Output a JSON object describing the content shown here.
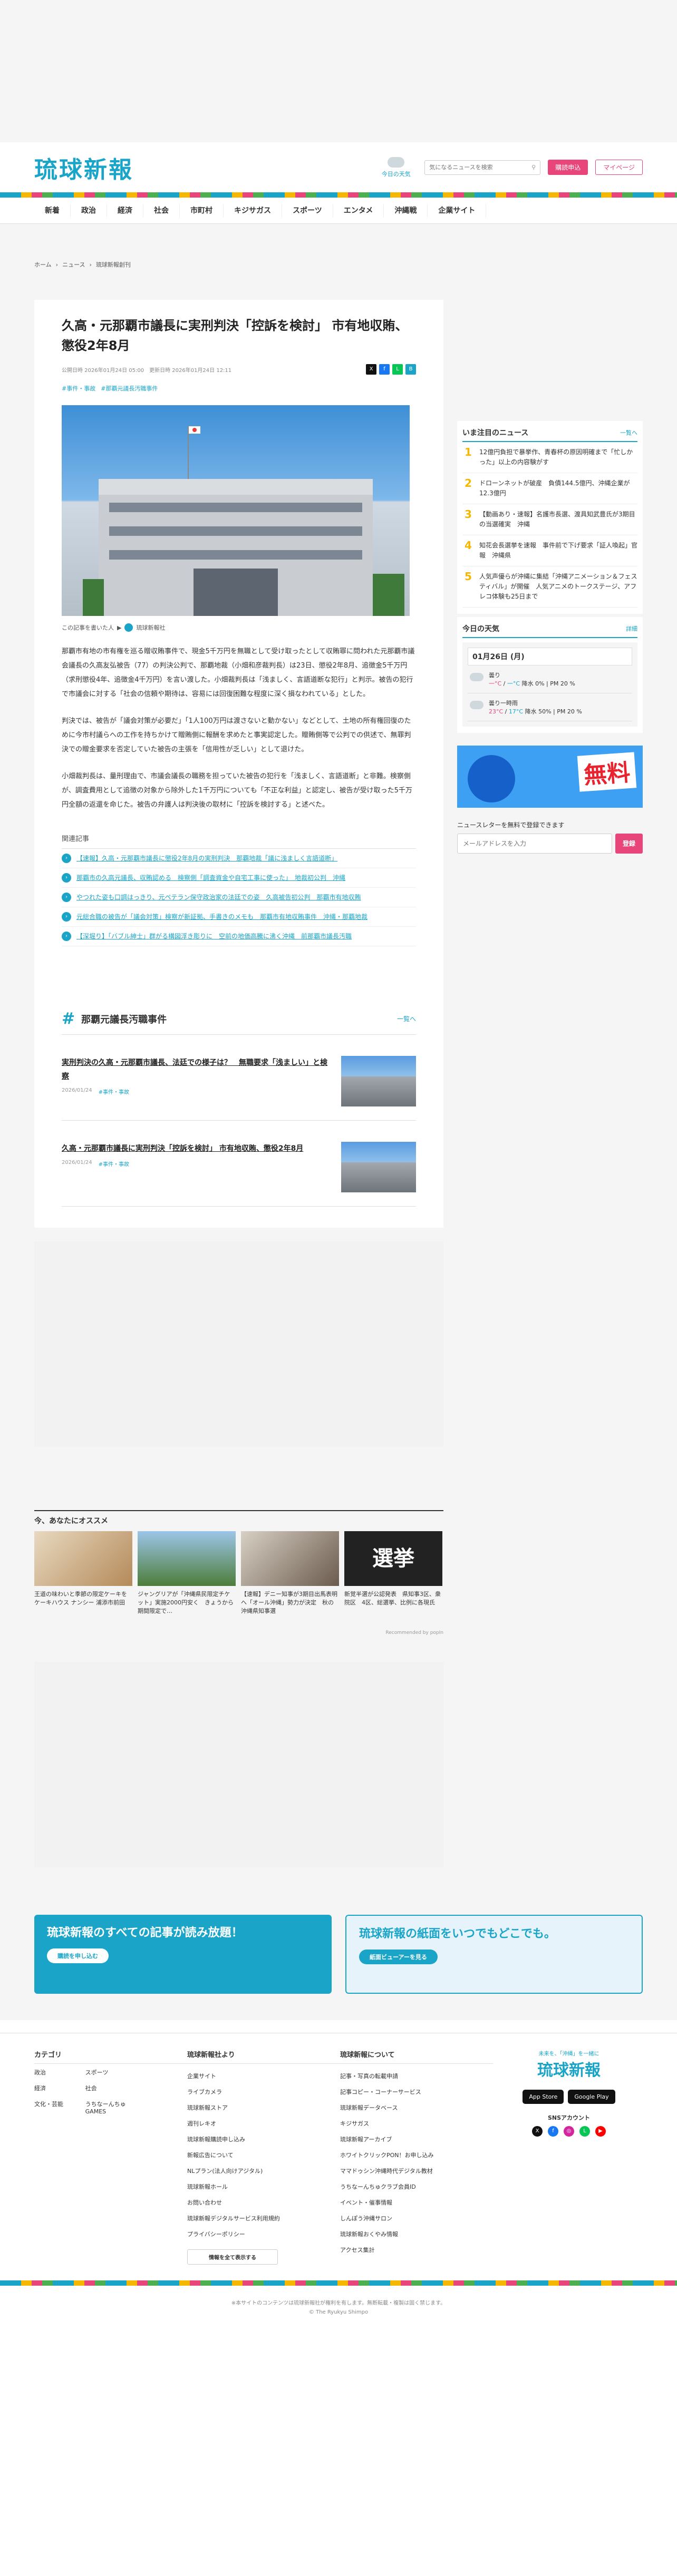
{
  "header": {
    "logo": "琉球新報",
    "weather_label": "今日の天気",
    "search_placeholder": "気になるニュースを検索",
    "subscribe_label": "購読申込",
    "mypage_label": "マイページ"
  },
  "nav": [
    "新着",
    "政治",
    "経済",
    "社会",
    "市町村",
    "キジサガス",
    "スポーツ",
    "エンタメ",
    "沖縄戦",
    "企業サイト"
  ],
  "breadcrumb": [
    "ホーム",
    "ニュース",
    "琉球新報創刊"
  ],
  "article": {
    "title": "久高・元那覇市議長に実刑判決「控訴を検討」 市有地収賄、懲役2年8月",
    "published": "公開日時 2026年01月24日 05:00",
    "updated": "更新日時 2026年01月24日 12:11",
    "tags": [
      "#事件・事故",
      "#那覇元議長汚職事件"
    ],
    "author_label": "この記事を書いた人",
    "author_name": "琉球新報社",
    "paragraphs": [
      "那覇市有地の市有権を巡る贈収賄事件で、現金5千万円を無職として受け取ったとして収賄罪に問われた元那覇市議会議長の久高友弘被告（77）の判決公判で、那覇地裁（小畑和彦裁判長）は23日、懲役2年8月、追徴金5千万円（求刑懲役4年、追徴金4千万円）を言い渡した。小畑裁判長は「浅ましく、言語道断な犯行」と判示。被告の犯行で市議会に対する「社会の信頼や期待は、容易には回復困難な程度に深く損なわれている」とした。",
      "判決では、被告が「議会対策が必要だ」「1人100万円は渡さないと動かない」などとして、土地の所有権回復のために今市村議らへの工作を持ちかけて贈賄側に報酬を求めたと事実認定した。贈賄側等で公判での供述で、無罪判決での贈金要求を否定していた被告の主張を「信用性が乏しい」として退けた。",
      "小畑裁判長は、量刑理由で、市議会議長の職務を担っていた被告の犯行を「浅ましく、言語道断」と非難。検察側が、調査費用として追徴の対象から除外した1千万円についても「不正な利益」と認定し、被告が受け取った5千万円全額の返還を命じた。被告の弁護人は判決後の取材に「控訴を検討する」と述べた。"
    ]
  },
  "related": {
    "heading": "関連記事",
    "items": [
      "【速報】久高・元那覇市議長に懲役2年8月の実刑判決　那覇地裁「議に浅ましく言語道断」",
      "那覇市の久高元議長、収賄認める　検察側「調査資金や自宅工事に使った」　地裁初公判　沖縄",
      "やつれた姿も口調はっきり、元ペテラン保守政治家の法廷での姿　久高被告初公判　那覇市有地収賄",
      "元総合職の被告が「議会対策」検察が新証拠、手書きのメモも　那覇市有地収賄事件　沖縄・那覇地裁",
      "【深堀り】「バブル紳士」群がる構図浮き彫りに　空前の地価高騰に沸く沖縄　前那覇市議長汚職"
    ]
  },
  "series": {
    "title": "那覇元議長汚職事件",
    "more": "一覧へ",
    "cards": [
      {
        "title": "実刑判決の久高・元那覇市議長、法廷での様子は？　無職要求「浅ましい」と検察",
        "date": "2026/01/24",
        "tag": "#事件・事故"
      },
      {
        "title": "久高・元那覇市議長に実刑判決「控訴を検討」 市有地収賄、懲役2年8月",
        "date": "2026/01/24",
        "tag": "#事件・事故"
      }
    ]
  },
  "sidebar": {
    "ranking_title": "いま注目のニュース",
    "ranking_more": "一覧へ",
    "ranking": [
      {
        "num": "1",
        "text": "12億円負担で暴挙作、青春杯の原因明確まで「忙しかった」以上の内容験がす"
      },
      {
        "num": "2",
        "text": "ドローンネットが破産　負債144.5億円、沖縄企業が12.3億円"
      },
      {
        "num": "3",
        "text": "【動画あり・速報】名護市長選、渡具知武豊氏が3期目の当選確実　沖縄"
      },
      {
        "num": "4",
        "text": "知花会長選挙を速報　事件前で下げ要求「証人喚起」官報　沖縄県"
      },
      {
        "num": "5",
        "text": "人気声優らが沖縄に集結「沖縄アニメーション＆フェスティバル」が開催　人気アニメのトークステージ、アフレコ体験も25日まで"
      }
    ],
    "weather_title": "今日の天気",
    "weather_more": "詳細",
    "weather_date": "01月26日 (月)",
    "weather_rows": [
      {
        "cond": "曇り",
        "hi": "一°C",
        "lo": "一°C",
        "rain": "降水 0% | PM 20 %"
      },
      {
        "cond": "曇り一時雨",
        "hi": "23°C",
        "lo": "17°C",
        "rain": "降水 50% | PM 20 %"
      }
    ],
    "promo_text": "無料",
    "newsletter_label": "ニュースレターを無料で登録できます",
    "newsletter_placeholder": "メールアドレスを入力",
    "newsletter_button": "登録"
  },
  "recommend": {
    "heading": "今、あなたにオススメ",
    "cards": [
      "王道の味わいと季節の限定ケーキを　ケーキハウス ナンシー 浦添市前田",
      "ジャングリアが「沖縄県民限定チケット」実施2000円安く　きょうから期間限定で…",
      "【速報】デニー知事が3期目出馬表明へ「オール沖縄」勢力が決定　秋の沖縄県知事選",
      "新覚半選が公認発表　県知事3区、衆院区　4区、総選挙、比例に各現氏"
    ],
    "footer": "Recommended by popIn"
  },
  "banners": [
    {
      "title": "琉球新報のすべての記事が読み放題！",
      "button": "購読を申し込む"
    },
    {
      "title": "琉球新報の紙面をいつでもどこでも。",
      "button": "紙面ビューアーを見る"
    }
  ],
  "footer": {
    "cat_title": "カテゴリ",
    "cats": [
      "政治",
      "経済",
      "社会",
      "文化・芸能",
      "スポーツ",
      "うちなーんちゅGAMES"
    ],
    "links_title": "琉球新報社より",
    "links": [
      "企業サイト",
      "ライブカメラ",
      "琉球新報ストア",
      "週刊レキオ",
      "琉球新報購読申し込み",
      "新報広告について",
      "NLプラン(法人向けアジタル)",
      "琉球新報ホール",
      "お問い合わせ",
      "琉球新報デジタルサービス利用規約",
      "プライバシーポリシー"
    ],
    "about_title": "琉球新報について",
    "about": [
      "記事・写真の転載申請",
      "記事コピー・コーナーサービス",
      "琉球新報データベース",
      "キジサガス",
      "琉球新報アーカイブ",
      "ホワイトクリックPON！お申し込み",
      "ママドゥシン沖縄時代デジタル教材",
      "うちなーんちゅクラブ会員ID",
      "イベント・催事情報",
      "しんぽう沖縄サロン",
      "琉球新報おくやみ情報",
      "アクセス集計"
    ],
    "more_button": "情報を全て表示する",
    "brand_tagline": "未来を、「沖縄」を一緒に",
    "brand_logo": "琉球新報",
    "app_store": "App Store",
    "google_play": "Google Play",
    "sns_label": "SNSアカウント",
    "copyright_note": "※本サイトのコンテンツは琉球新報社が権利を有します。無断転載・複製は固く禁じます。",
    "copyright": "© The Ryukyu Shimpo"
  }
}
